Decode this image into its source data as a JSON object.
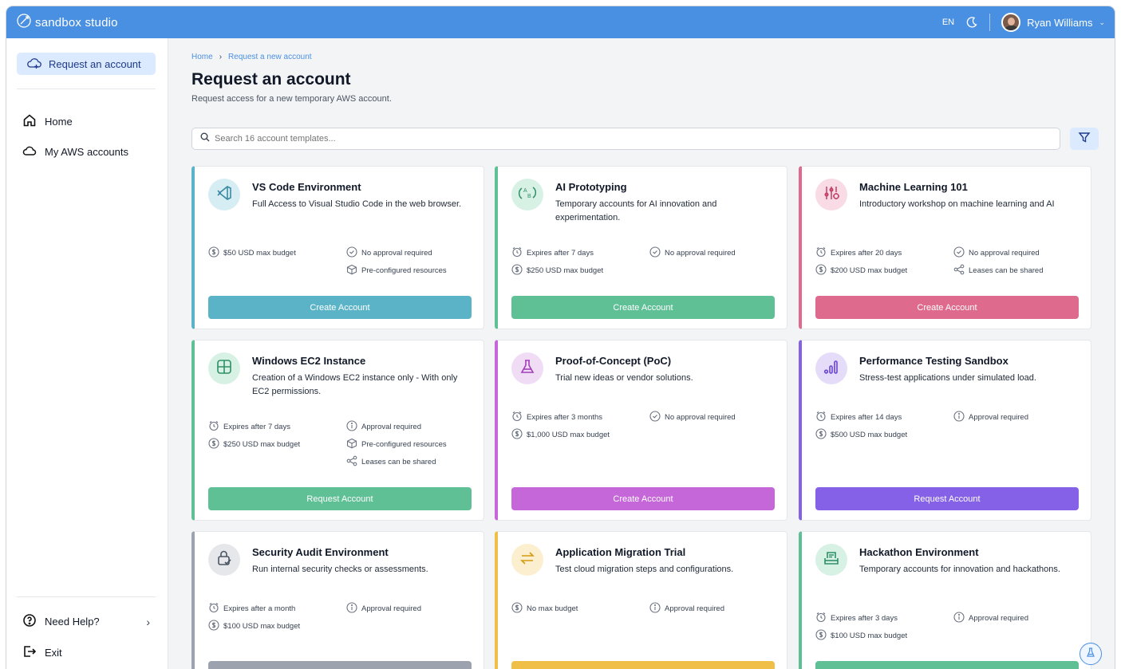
{
  "app": {
    "brand": "sandbox studio"
  },
  "topbar": {
    "language": "EN",
    "user_name": "Ryan Williams"
  },
  "sidebar": {
    "request_label": "Request an account",
    "items": [
      {
        "label": "Home",
        "icon": "home-icon"
      },
      {
        "label": "My AWS accounts",
        "icon": "cloud-icon"
      }
    ],
    "help_label": "Need Help?",
    "exit_label": "Exit"
  },
  "breadcrumb": {
    "home": "Home",
    "current": "Request a new account"
  },
  "page": {
    "title": "Request an account",
    "subtitle": "Request access for a new temporary AWS account."
  },
  "search": {
    "placeholder": "Search 16 account templates..."
  },
  "cards": [
    {
      "title": "VS Code Environment",
      "desc": "Full Access to Visual Studio Code in the web browser.",
      "color": "#5bb3c8",
      "icon_bg": "#d6edf3",
      "icon": "vscode-icon",
      "features": [
        "$50 USD max budget",
        "No approval required",
        "Pre-configured resources"
      ],
      "button": "Create Account"
    },
    {
      "title": "AI Prototyping",
      "desc": "Temporary accounts for AI innovation and experimentation.",
      "color": "#5fbf95",
      "icon_bg": "#d8f1e5",
      "icon": "ab-test-icon",
      "features": [
        "Expires after 7 days",
        "No approval required",
        "$250 USD max budget"
      ],
      "button": "Create Account"
    },
    {
      "title": "Machine Learning 101",
      "desc": "Introductory workshop on machine learning and AI",
      "color": "#de6b8e",
      "icon_bg": "#f8dbe4",
      "icon": "ml-sliders-icon",
      "features": [
        "Expires after 20 days",
        "No approval required",
        "$200 USD max budget",
        "Leases can be shared"
      ],
      "button": "Create Account"
    },
    {
      "title": "Windows EC2 Instance",
      "desc": "Creation of a Windows EC2 instance only - With only EC2 permissions.",
      "color": "#5fbf95",
      "icon_bg": "#d8f1e5",
      "icon": "windows-icon",
      "features": [
        "Expires after 7 days",
        "Approval required",
        "$250 USD max budget",
        "Pre-configured resources",
        "Leases can be shared"
      ],
      "button": "Request Account"
    },
    {
      "title": "Proof-of-Concept (PoC)",
      "desc": "Trial new ideas or vendor solutions.",
      "color": "#c566d9",
      "icon_bg": "#f1dcf6",
      "icon": "flask-icon",
      "features": [
        "Expires after 3 months",
        "No approval required",
        "$1,000 USD max budget"
      ],
      "button": "Create Account"
    },
    {
      "title": "Performance Testing Sandbox",
      "desc": "Stress-test applications under simulated load.",
      "color": "#8461e6",
      "icon_bg": "#e5dcfa",
      "icon": "bar-chart-icon",
      "features": [
        "Expires after 14 days",
        "Approval required",
        "$500 USD max budget"
      ],
      "button": "Request Account"
    },
    {
      "title": "Security Audit Environment",
      "desc": "Run internal security checks or assessments.",
      "color": "#9ca3af",
      "icon_bg": "#e5e7eb",
      "icon": "lock-check-icon",
      "features": [
        "Expires after a month",
        "Approval required",
        "$100 USD max budget"
      ],
      "button": ""
    },
    {
      "title": "Application Migration Trial",
      "desc": "Test cloud migration steps and configurations.",
      "color": "#f0bf48",
      "icon_bg": "#fcefcf",
      "icon": "migrate-arrows-icon",
      "features": [
        "No max budget",
        "Approval required"
      ],
      "button": ""
    },
    {
      "title": "Hackathon Environment",
      "desc": "Temporary accounts for innovation and hackathons.",
      "color": "#5fbf95",
      "icon_bg": "#d8f1e5",
      "icon": "hackathon-icon",
      "features": [
        "Expires after 3 days",
        "Approval required",
        "$100 USD max budget"
      ],
      "button": ""
    }
  ]
}
